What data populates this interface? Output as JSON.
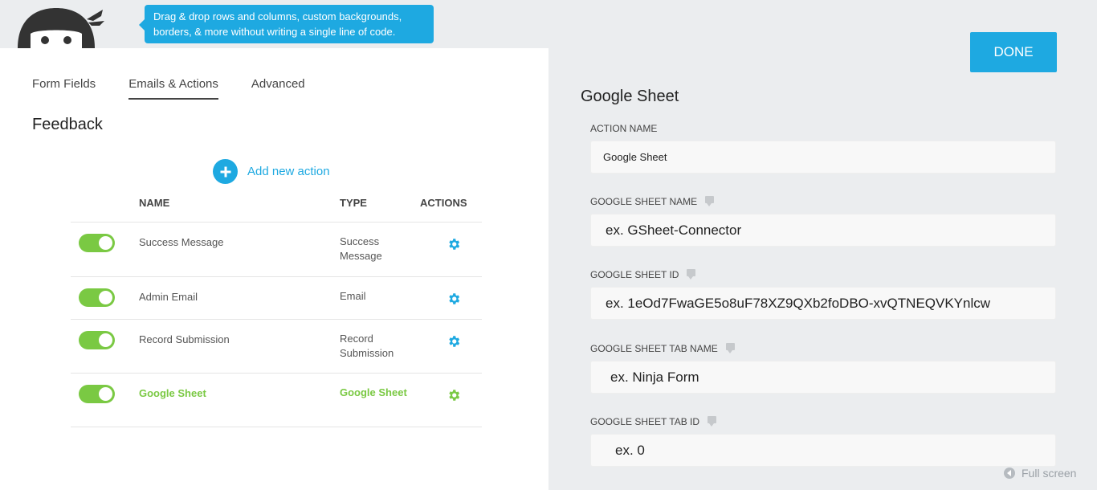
{
  "header": {
    "tooltip": "Drag & drop rows and columns, custom backgrounds, borders, & more without writing a single line of code."
  },
  "tabs": [
    {
      "label": "Form Fields",
      "active": false
    },
    {
      "label": "Emails & Actions",
      "active": true
    },
    {
      "label": "Advanced",
      "active": false
    }
  ],
  "form_title": "Feedback",
  "add_action_label": "Add new action",
  "table": {
    "headers": {
      "name": "NAME",
      "type": "TYPE",
      "actions": "ACTIONS"
    },
    "rows": [
      {
        "name": "Success Message",
        "type": "Success Message",
        "enabled": true
      },
      {
        "name": "Admin Email",
        "type": "Email",
        "enabled": true
      },
      {
        "name": "Record Submission",
        "type": "Record Submission",
        "enabled": true
      },
      {
        "name": "Google Sheet",
        "type": "Google Sheet",
        "enabled": true,
        "highlighted": true
      }
    ]
  },
  "done_label": "DONE",
  "settings": {
    "title": "Google Sheet",
    "fields": [
      {
        "label": "ACTION NAME",
        "value": "Google Sheet",
        "placeholder": "",
        "help": false
      },
      {
        "label": "GOOGLE SHEET NAME",
        "value": "",
        "placeholder": "ex. GSheet-Connector",
        "help": true
      },
      {
        "label": "GOOGLE SHEET ID",
        "value": "",
        "placeholder": "ex. 1eOd7FwaGE5o8uF78XZ9QXb2foDBO-xvQTNEQVKYnlcw",
        "help": true
      },
      {
        "label": "GOOGLE SHEET TAB NAME",
        "value": "",
        "placeholder": "ex. Ninja Form",
        "help": true
      },
      {
        "label": "GOOGLE SHEET TAB ID",
        "value": "",
        "placeholder": "ex. 0",
        "help": true
      }
    ]
  },
  "fullscreen_label": "Full screen",
  "colors": {
    "accent": "#1ea9e1",
    "toggle_on": "#7ac943",
    "highlight": "#7ac943"
  }
}
